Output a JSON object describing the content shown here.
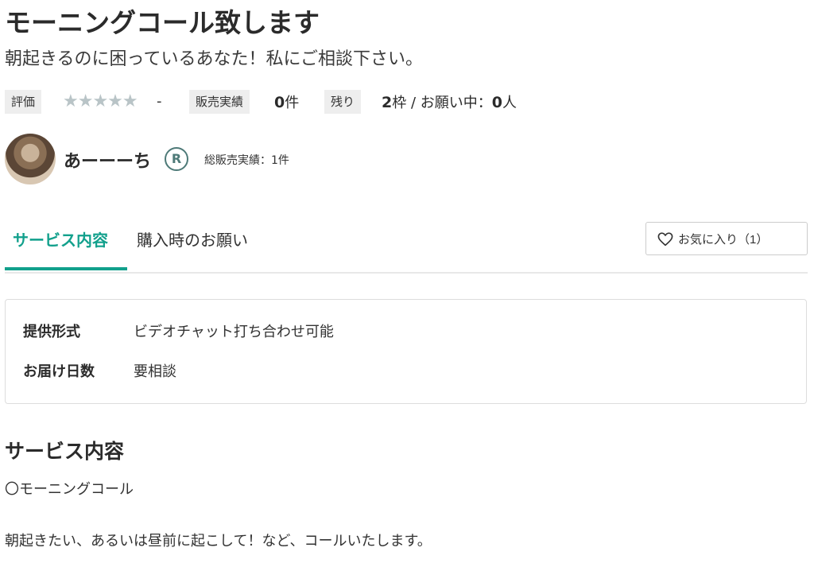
{
  "service": {
    "title": "モーニングコール致します",
    "subtitle": "朝起きるのに困っているあなた！私にご相談下さい。"
  },
  "stats": {
    "rating_label": "評価",
    "rating_stars": 0,
    "rating_stars_glyph": "★★★★★",
    "rating_value": "-",
    "sales_label": "販売実績",
    "sales_count": "0",
    "sales_unit": "件",
    "remaining_label": "残り",
    "remaining_count": "2",
    "remaining_unit": "枠",
    "requests_text": " / お願い中：",
    "requests_count": "0",
    "requests_unit": "人"
  },
  "seller": {
    "name": "あーーーち",
    "rank_badge": "R",
    "total_sales": "総販売実績：1件"
  },
  "tabs": [
    {
      "label": "サービス内容",
      "active": true
    },
    {
      "label": "購入時のお願い",
      "active": false
    }
  ],
  "favorite": {
    "label": "お気に入り（1）",
    "icon": "heart-icon"
  },
  "info": [
    {
      "key": "提供形式",
      "value": "ビデオチャット打ち合わせ可能"
    },
    {
      "key": "お届け日数",
      "value": "要相談"
    }
  ],
  "section": {
    "heading": "サービス内容",
    "lines": [
      "〇モーニングコール",
      "朝起きたい、あるいは昼前に起こして！など、コールいたします。"
    ]
  },
  "colors": {
    "accent": "#12a08c",
    "star_empty": "#b9c4c7",
    "tag_bg": "#eeeeee",
    "badge": "#4e7a78"
  }
}
